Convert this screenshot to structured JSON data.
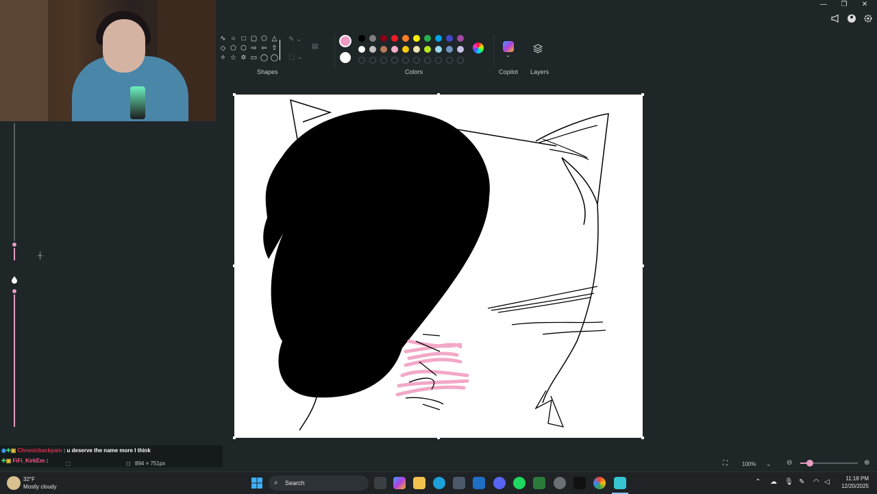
{
  "ribbon": {
    "groups": {
      "shapes": "Shapes",
      "colors": "Colors",
      "copilot": "Copilot",
      "layers": "Layers"
    },
    "shapes_glyphs": [
      "∿",
      "○",
      "□",
      "▢",
      "⬠",
      "△",
      "◇",
      "⬠",
      "⬡",
      "⇨",
      "⇦",
      "⇧",
      "✧",
      "☆",
      "✡",
      "▭",
      "◯",
      "◯"
    ],
    "active_color_1": "#ee9ac2",
    "active_color_2": "#ffffff",
    "palette_row_1": [
      "#000000",
      "#7f7f7f",
      "#880015",
      "#ed1c24",
      "#ff7f27",
      "#fff200",
      "#22b14c",
      "#00a2e8",
      "#3f48cc",
      "#a349a4"
    ],
    "palette_row_2": [
      "#ffffff",
      "#c3c3c3",
      "#b97a57",
      "#ffaec9",
      "#ffc90e",
      "#efe4b0",
      "#b5e61d",
      "#99d9ea",
      "#7092be",
      "#c8bfe7"
    ]
  },
  "chat": {
    "line1_user": "Chronicbackpain",
    "line1_text": " : u deserve the name more I think",
    "line2_user": "FiFi_KirkEm",
    "line2_text": " :"
  },
  "status": {
    "canvas_size": "894 × 751px",
    "zoom": "100%"
  },
  "taskbar": {
    "temp": "32°F",
    "weather": "Mostly cloudy",
    "search_label": "Search",
    "time": "11:18 PM",
    "date": "12/20/2025"
  }
}
